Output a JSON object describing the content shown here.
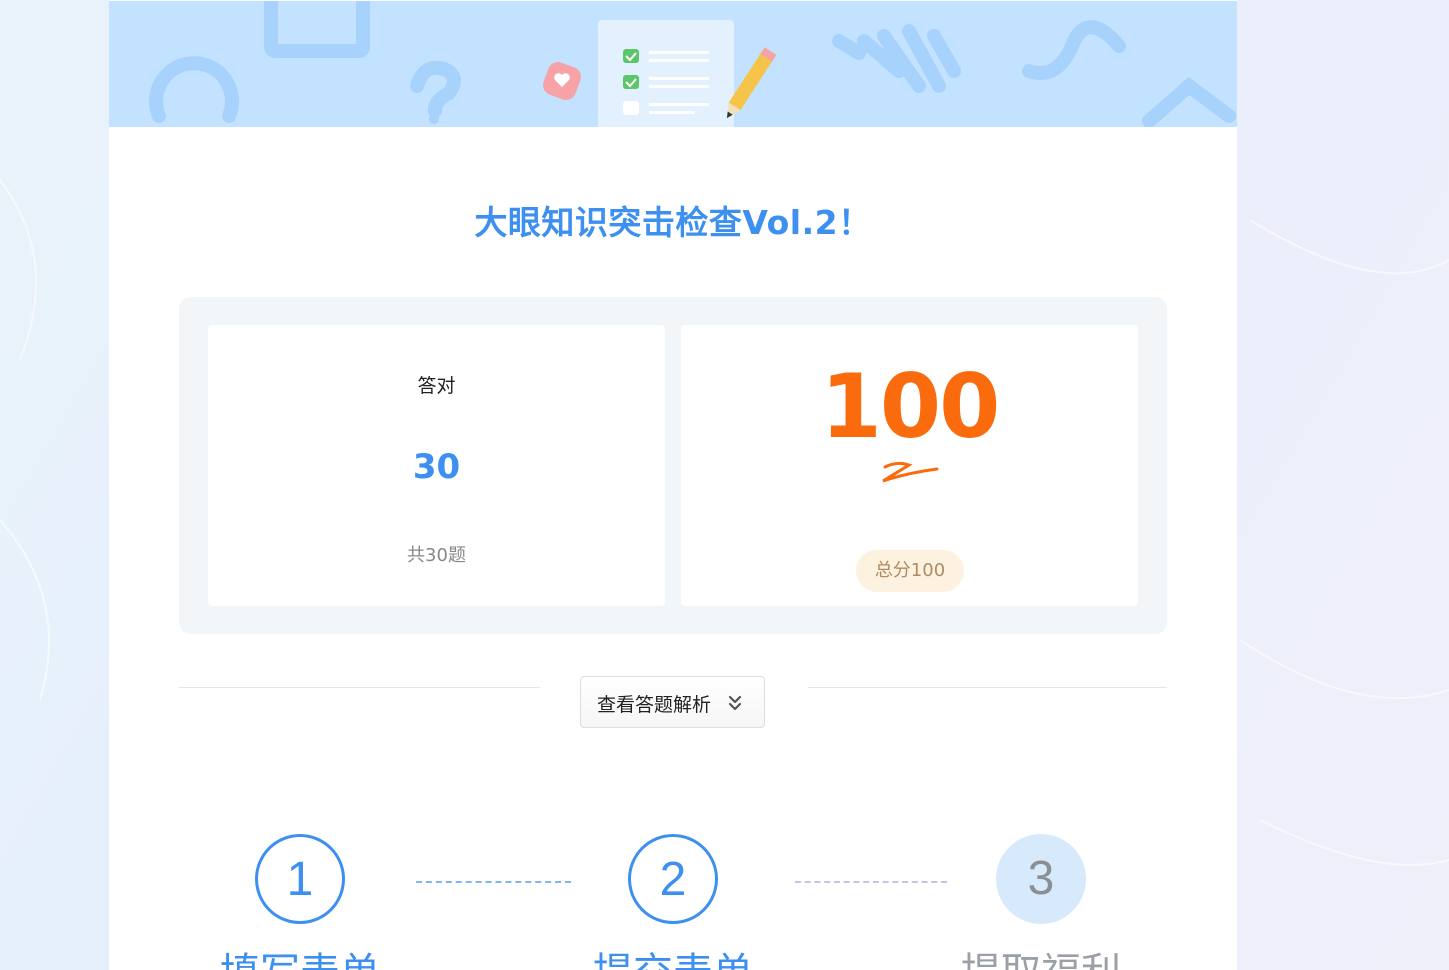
{
  "quiz": {
    "title": "大眼知识突击检查Vol.2！"
  },
  "result": {
    "correct_label": "答对",
    "correct_count": "30",
    "total_questions_text": "共30题",
    "score": "100",
    "total_score_text": "总分100"
  },
  "actions": {
    "view_analysis_label": "查看答题解析"
  },
  "steps": [
    {
      "number": "1",
      "label": "填写表单",
      "state": "active"
    },
    {
      "number": "2",
      "label": "提交表单",
      "state": "active"
    },
    {
      "number": "3",
      "label": "提取福利",
      "state": "inactive"
    }
  ],
  "colors": {
    "accent_blue": "#3d8ff0",
    "score_orange": "#f96b0c",
    "banner_bg": "#c3e2ff"
  },
  "icons": [
    "checklist-icon",
    "heart-bubble-icon",
    "pencil-icon",
    "chevron-double-down-icon",
    "score-swoosh-icon"
  ]
}
